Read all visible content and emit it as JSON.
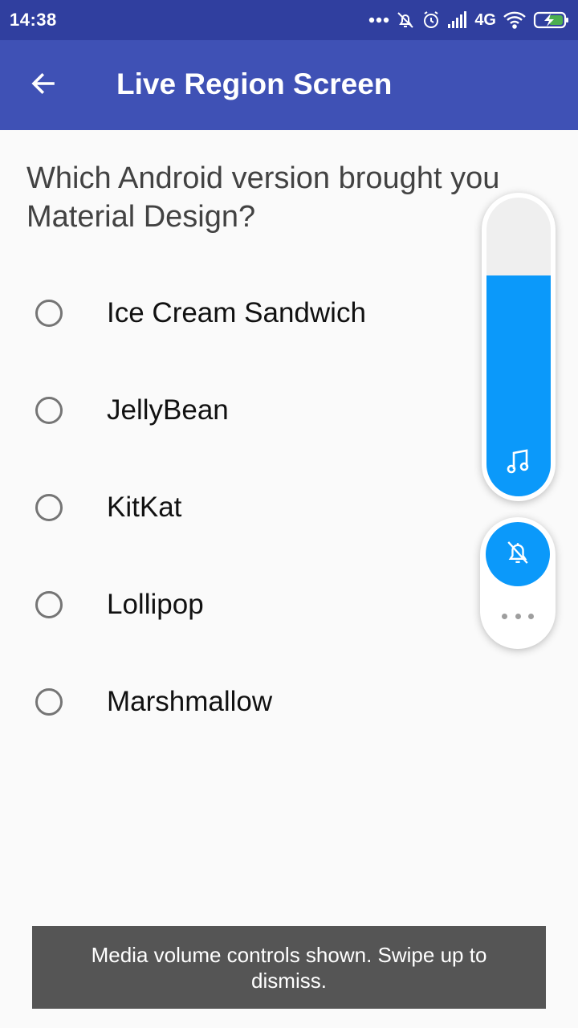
{
  "status_bar": {
    "time": "14:38",
    "network": "4G",
    "icons": [
      "more-dots-icon",
      "notifications-muted-icon",
      "alarm-icon",
      "signal-icon",
      "network-type",
      "wifi-icon",
      "battery-charging-icon"
    ]
  },
  "app_bar": {
    "back_icon": "arrow-back-icon",
    "title": "Live Region Screen"
  },
  "question": "Which Android version brought you Material Design?",
  "options": [
    {
      "label": "Ice Cream Sandwich",
      "selected": false
    },
    {
      "label": "JellyBean",
      "selected": false
    },
    {
      "label": "KitKat",
      "selected": false
    },
    {
      "label": "Lollipop",
      "selected": false
    },
    {
      "label": "Marshmallow",
      "selected": false
    }
  ],
  "volume_overlay": {
    "media_level_fraction": 0.74,
    "media_icon": "music-note-icon",
    "ringer_icon": "bell-off-icon",
    "more_icon": "more-horizontal-icon",
    "accent_color": "#0b99fa"
  },
  "toast": {
    "message": "Media volume controls shown. Swipe up to dismiss."
  },
  "colors": {
    "status_bar": "#303f9f",
    "app_bar": "#3f51b5",
    "background": "#fafafa",
    "toast_background": "#555555"
  }
}
